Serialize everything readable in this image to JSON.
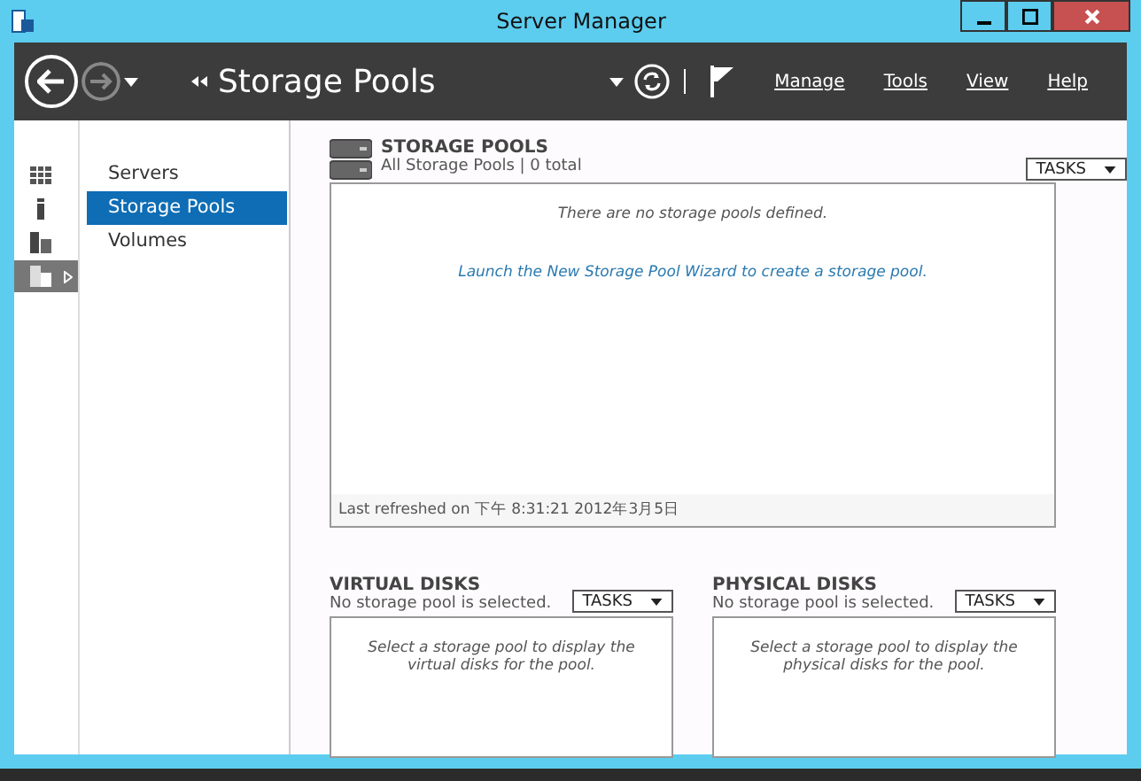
{
  "window": {
    "title": "Server Manager"
  },
  "header": {
    "breadcrumb": "Storage Pools",
    "menu": [
      "Manage",
      "Tools",
      "View",
      "Help"
    ]
  },
  "icon_bar": [
    {
      "kind": "dashboard",
      "selected": false
    },
    {
      "kind": "server",
      "selected": false
    },
    {
      "kind": "servers",
      "selected": false
    },
    {
      "kind": "files",
      "selected": true
    }
  ],
  "nav": [
    {
      "label": "Servers",
      "selected": false
    },
    {
      "label": "Storage Pools",
      "selected": true
    },
    {
      "label": "Volumes",
      "selected": false
    }
  ],
  "storage_pools": {
    "title": "STORAGE POOLS",
    "subtitle": "All Storage Pools | 0 total",
    "tasks": "TASKS",
    "message": "There are no storage pools defined.",
    "link": "Launch the New Storage Pool Wizard to create a storage pool.",
    "footer": "Last refreshed on 下午 8:31:21 2012年3月5日"
  },
  "panels": [
    {
      "title": "VIRTUAL DISKS",
      "subtitle": "No storage pool is selected.",
      "tasks": "TASKS",
      "message": "Select a storage pool to display the virtual disks for the pool."
    },
    {
      "title": "PHYSICAL DISKS",
      "subtitle": "No storage pool is selected.",
      "tasks": "TASKS",
      "message": "Select a storage pool to display the physical disks for the pool."
    }
  ]
}
